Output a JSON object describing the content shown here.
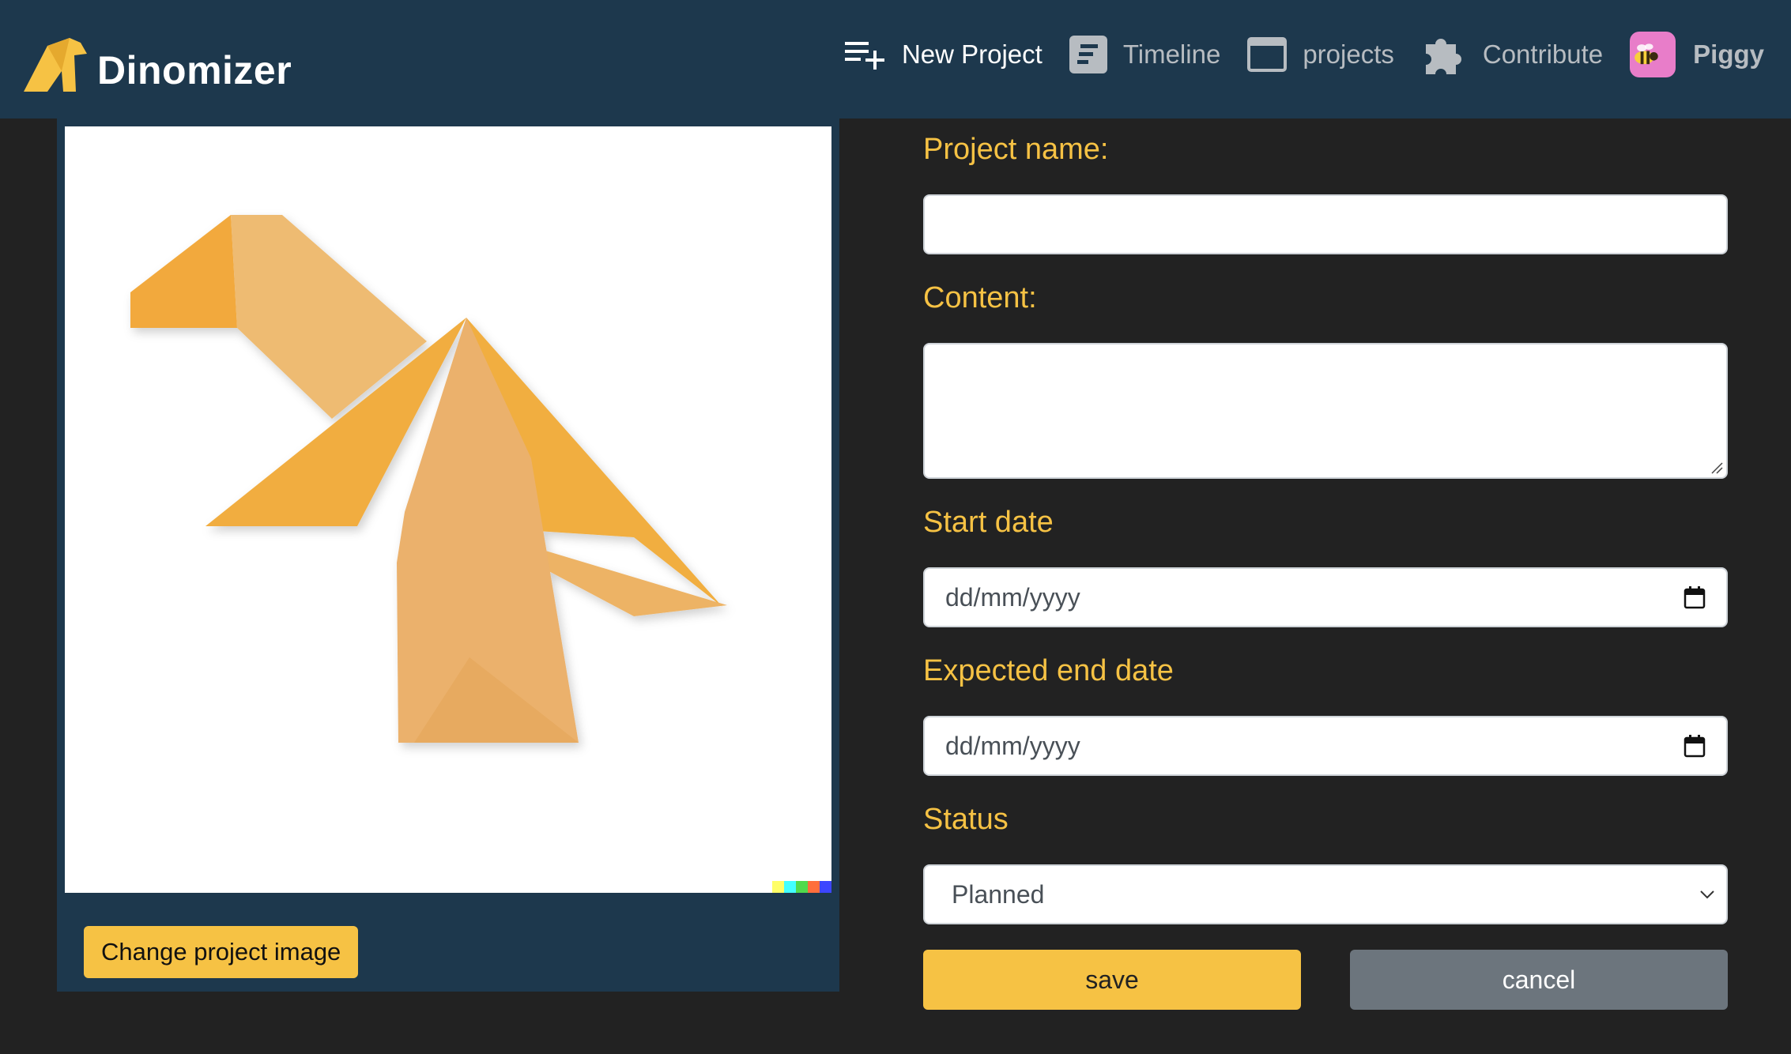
{
  "brand": {
    "name": "Dinomizer",
    "accent": "#f6c244",
    "header_bg": "#1d384d"
  },
  "nav": {
    "new_project": "New Project",
    "timeline": "Timeline",
    "projects": "projects",
    "contribute": "Contribute",
    "user": "Piggy"
  },
  "image_panel": {
    "change_button": "Change project image",
    "image_subject": "orange origami dinosaur"
  },
  "form": {
    "name_label": "Project name:",
    "name_value": "",
    "content_label": "Content:",
    "content_value": "",
    "start_label": "Start date",
    "start_placeholder": "dd/mm/yyyy",
    "end_label": "Expected end date",
    "end_placeholder": "dd/mm/yyyy",
    "status_label": "Status",
    "status_selected": "Planned",
    "save": "save",
    "cancel": "cancel"
  }
}
